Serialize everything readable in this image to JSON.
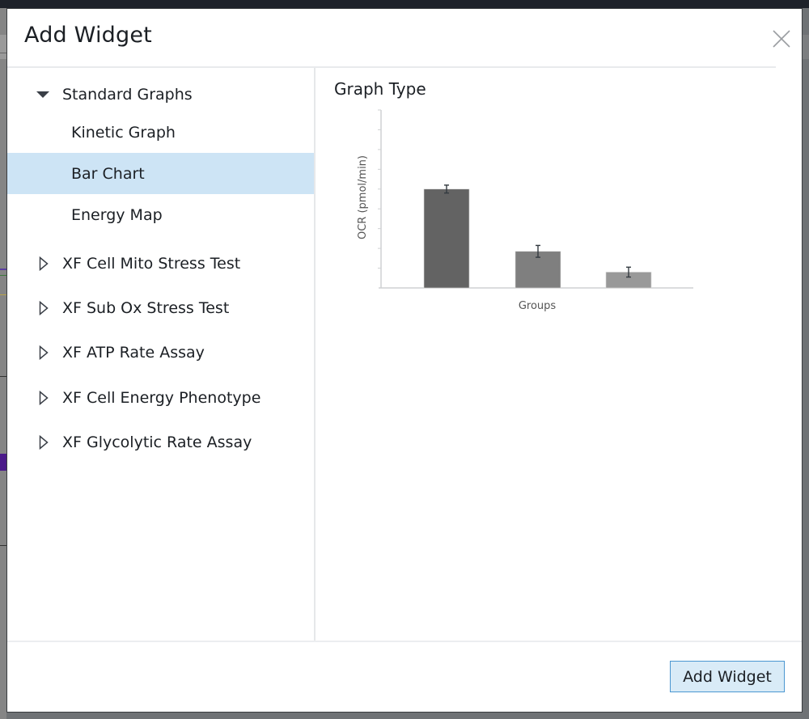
{
  "dialog": {
    "title": "Add Widget",
    "close_icon": "close-icon"
  },
  "tree": {
    "groups": [
      {
        "label": "Standard Graphs",
        "expanded": true,
        "icon": "caret-down-filled-icon",
        "children": [
          {
            "label": "Kinetic Graph",
            "selected": false
          },
          {
            "label": "Bar Chart",
            "selected": true
          },
          {
            "label": "Energy Map",
            "selected": false
          }
        ]
      },
      {
        "label": "XF Cell Mito Stress Test",
        "expanded": false,
        "icon": "caret-right-outline-icon"
      },
      {
        "label": "XF Sub Ox Stress Test",
        "expanded": false,
        "icon": "caret-right-outline-icon"
      },
      {
        "label": "XF ATP Rate Assay",
        "expanded": false,
        "icon": "caret-right-outline-icon"
      },
      {
        "label": "XF Cell Energy Phenotype",
        "expanded": false,
        "icon": "caret-right-outline-icon"
      },
      {
        "label": "XF Glycolytic Rate Assay",
        "expanded": false,
        "icon": "caret-right-outline-icon"
      }
    ]
  },
  "preview": {
    "title": "Graph Type"
  },
  "chart_data": {
    "type": "bar",
    "title": "",
    "xlabel": "Groups",
    "ylabel": "OCR (pmol/min)",
    "categories": [
      "",
      "",
      ""
    ],
    "values": [
      5.0,
      1.85,
      0.8
    ],
    "errors": [
      0.2,
      0.3,
      0.25
    ],
    "colors": [
      "#636363",
      "#7f7f7f",
      "#999999"
    ],
    "ylim": [
      0,
      9
    ],
    "ytick_count": 9,
    "ytick_labels": [],
    "grid": false,
    "legend": "none"
  },
  "footer": {
    "add_button_label": "Add Widget"
  },
  "colors": {
    "selection_bg": "#cde4f5",
    "button_bg": "#d9ebf7",
    "button_border": "#4b97d1"
  }
}
